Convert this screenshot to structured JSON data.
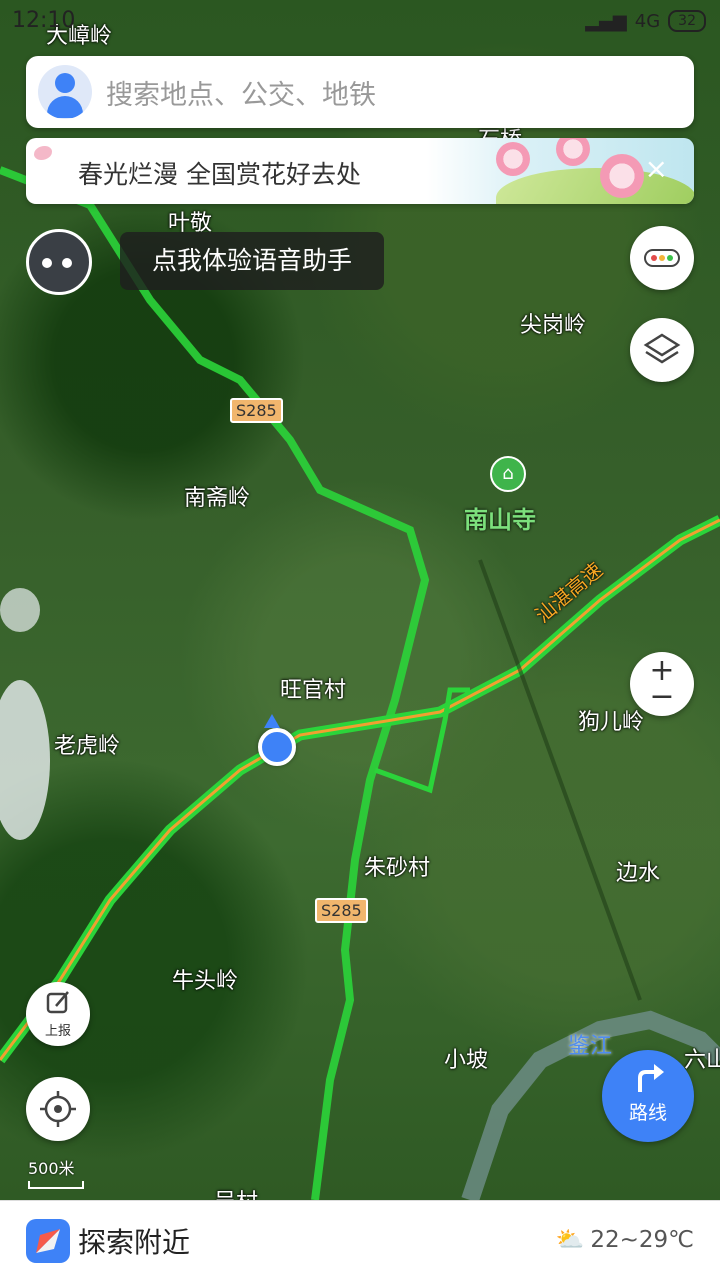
{
  "status": {
    "time": "12:10",
    "network": "4G",
    "battery": "32"
  },
  "search": {
    "placeholder": "搜索地点、公交、地铁"
  },
  "banner": {
    "text": "春光烂漫 全国赏花好去处",
    "close": "×"
  },
  "voice": {
    "tip": "点我体验语音助手"
  },
  "map": {
    "labels": [
      "大嶂岭",
      "石桥",
      "叶敬",
      "尖岗岭",
      "南斋岭",
      "南山寺",
      "旺官村",
      "老虎岭",
      "狗儿岭",
      "朱砂村",
      "边水",
      "牛头岭",
      "小坡",
      "鉴江",
      "六山",
      "吴村"
    ],
    "roads": [
      "S285",
      "S285",
      "汕湛高速"
    ]
  },
  "controls": {
    "zoom_in": "+",
    "zoom_out": "−",
    "report": "上报",
    "scale": "500米",
    "route": "路线"
  },
  "bottom": {
    "title": "探索附近",
    "weather": "22~29℃"
  },
  "colors": {
    "accent": "#3e82f7",
    "route_green": "#35d43a"
  }
}
